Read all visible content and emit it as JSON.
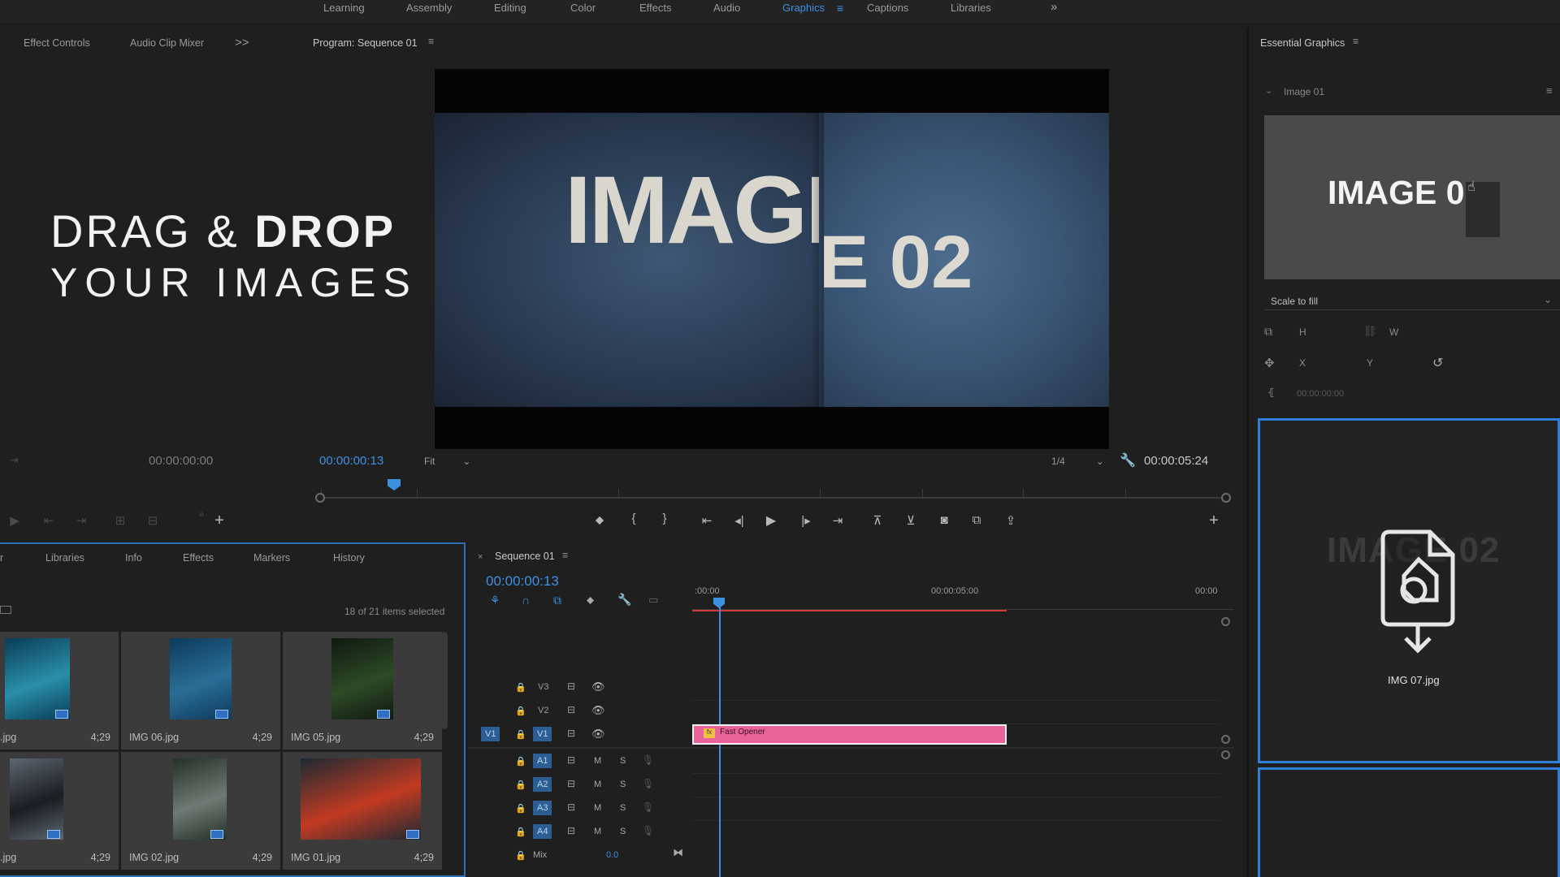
{
  "workspace_tabs": [
    {
      "label": "Learning",
      "active": false
    },
    {
      "label": "Assembly",
      "active": false
    },
    {
      "label": "Editing",
      "active": false
    },
    {
      "label": "Color",
      "active": false
    },
    {
      "label": "Effects",
      "active": false
    },
    {
      "label": "Audio",
      "active": false
    },
    {
      "label": "Graphics",
      "active": true
    },
    {
      "label": "Captions",
      "active": false
    },
    {
      "label": "Libraries",
      "active": false
    }
  ],
  "source_panel": {
    "tabs": [
      "Effect Controls",
      "Audio Clip Mixer"
    ],
    "more": ">>"
  },
  "program": {
    "title": "Program: Sequence 01",
    "in_timecode": "00:00:00:00",
    "current_timecode": "00:00:00:13",
    "fit_label": "Fit",
    "resolution_label": "1/4",
    "duration": "00:00:05:24",
    "video_left_text": "IMAGE",
    "video_right_text": "E 02"
  },
  "overlay": {
    "line1_light": "DRAG & ",
    "line1_bold": "DROP",
    "line2": "YOUR IMAGES"
  },
  "project_panel": {
    "tabs": [
      "r",
      "Libraries",
      "Info",
      "Effects",
      "Markers",
      "History"
    ],
    "selection_status": "18 of 21 items selected",
    "items": [
      {
        "name": ".jpg",
        "duration": "4;29",
        "colors": [
          "#0a3c57",
          "#2a8fa8"
        ]
      },
      {
        "name": "IMG 06.jpg",
        "duration": "4;29",
        "colors": [
          "#0d3a5c",
          "#2a6e95"
        ]
      },
      {
        "name": "IMG 05.jpg",
        "duration": "4;29",
        "colors": [
          "#0f1a10",
          "#2d4a26"
        ]
      },
      {
        "name": ".jpg",
        "duration": "4;29",
        "colors": [
          "#5e6670",
          "#1a1d22"
        ]
      },
      {
        "name": "IMG 02.jpg",
        "duration": "4;29",
        "colors": [
          "#253029",
          "#6f7a74"
        ]
      },
      {
        "name": "IMG 01.jpg",
        "duration": "4;29",
        "colors": [
          "#1d2a33",
          "#c23a22"
        ]
      }
    ]
  },
  "timeline": {
    "title": "Sequence 01",
    "timecode": "00:00:00:13",
    "ruler_labels": [
      ":00:00",
      "00:00:05:00",
      "00:00"
    ],
    "video_tracks": [
      "V3",
      "V2",
      "V1"
    ],
    "audio_tracks": [
      "A1",
      "A2",
      "A3",
      "A4"
    ],
    "source_patch": "V1",
    "mute_label": "M",
    "solo_label": "S",
    "mix_label": "Mix",
    "mix_value": "0.0",
    "clip_label": "Fast Opener"
  },
  "essential_graphics": {
    "title": "Essential Graphics",
    "layer_name": "Image 01",
    "preview_text": "IMAGE 0",
    "scale_mode": "Scale to fill",
    "h_label": "H",
    "w_label": "W",
    "x_label": "X",
    "y_label": "Y",
    "time_field": "00:00:00:00",
    "drop_ghost_text": "IMAGE 02",
    "drop_file": "IMG 07.jpg"
  },
  "colors": {
    "accent_blue": "#3d8fe0",
    "clip_pink": "#e8639a",
    "panel_bg": "#1f1f1f"
  }
}
